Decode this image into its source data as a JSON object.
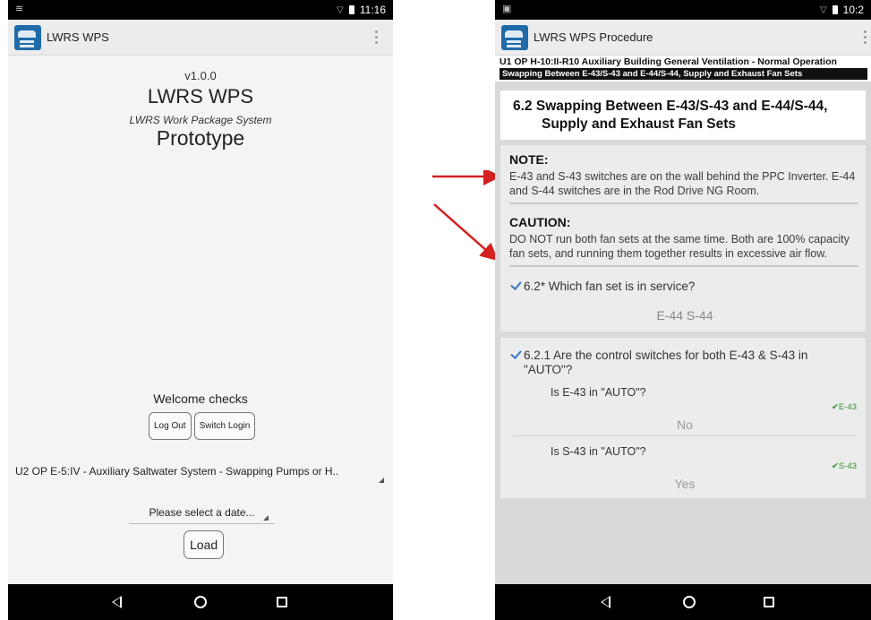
{
  "left": {
    "status_time": "11:16",
    "app_title": "LWRS WPS",
    "version": "v1.0.0",
    "name": "LWRS WPS",
    "subtitle": "LWRS Work Package System",
    "prototype": "Prototype",
    "welcome": "Welcome checks",
    "logout_label": "Log Out",
    "switch_label": "Switch Login",
    "procedure_select": "U2 OP E-5:IV - Auxiliary Saltwater System - Swapping Pumps or H..",
    "date_select": "Please select a date...",
    "load_label": "Load"
  },
  "right": {
    "status_time": "10:2",
    "app_title": "LWRS WPS Procedure",
    "proc_line1": "U1 OP H-10:II-R10 Auxiliary Building General Ventilation - Normal Operation",
    "proc_line2": "Swapping Between E-43/S-43 and E-44/S-44, Supply and Exhaust Fan Sets",
    "section_title_1": "6.2 Swapping Between E-43/S-43 and E-44/S-44,",
    "section_title_2": "Supply and Exhaust Fan Sets",
    "note_heading": "NOTE:",
    "note_text": "E-43 and S-43 switches are on the wall behind the PPC Inverter. E-44 and S-44 switches are in the Rod Drive NG Room.",
    "caution_heading": "CAUTION:",
    "caution_text": "DO NOT run both fan sets at the same time. Both are 100% capacity fan sets, and running them together results in excessive air flow.",
    "step1_q": "6.2* Which fan set is in service?",
    "step1_ans": "E-44 S-44",
    "step2_q": "6.2.1 Are the control switches for both E-43 & S-43 in \"AUTO\"?",
    "sub1_q": "Is E-43 in \"AUTO\"?",
    "sub1_tag": "E-43",
    "sub1_ans": "No",
    "sub2_q": "Is S-43 in \"AUTO\"?",
    "sub2_tag": "S-43",
    "sub2_ans": "Yes"
  },
  "colors": {
    "arrow": "#d42020",
    "check_blue": "#3a77c4",
    "tag_green": "#2f8f2f"
  }
}
